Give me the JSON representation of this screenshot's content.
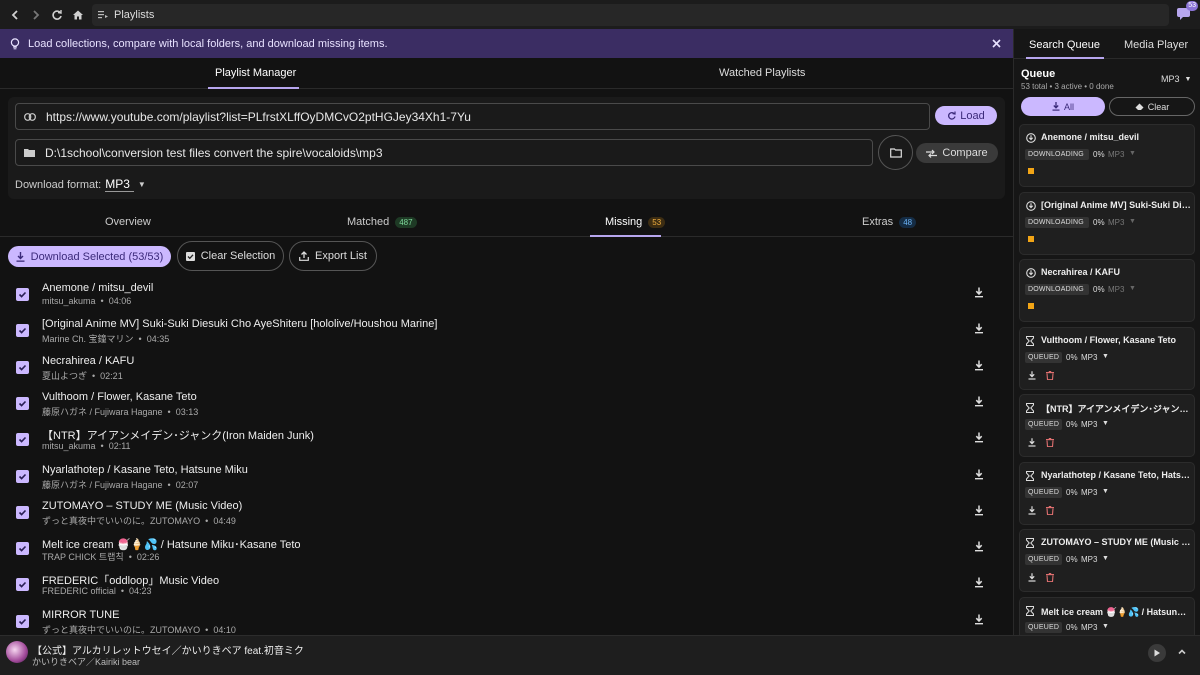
{
  "topbar": {
    "address": "Playlists",
    "notification_count": "53"
  },
  "info_bar": {
    "message": "Load collections, compare with local folders, and download missing items."
  },
  "top_tabs": [
    {
      "label": "Playlist Manager"
    },
    {
      "label": "Watched Playlists"
    }
  ],
  "form": {
    "url_value": "https://www.youtube.com/playlist?list=PLfrstXLffOyDMCvO2ptHGJey34Xh1-7Yu",
    "path_value": "D:\\1school\\conversion test files convert the spire\\vocaloids\\mp3",
    "load_label": "Load",
    "compare_label": "Compare",
    "format_label": "Download format:",
    "format_value": "MP3"
  },
  "sub_tabs": [
    {
      "label": "Overview",
      "badge": ""
    },
    {
      "label": "Matched",
      "badge": "487"
    },
    {
      "label": "Missing",
      "badge": "53"
    },
    {
      "label": "Extras",
      "badge": "48"
    }
  ],
  "actions": {
    "download_selected": "Download Selected (53/53)",
    "clear_selection": "Clear Selection",
    "export_list": "Export List"
  },
  "tracks": [
    {
      "title": "Anemone / mitsu_devil",
      "channel": "mitsu_akuma",
      "duration": "04:06"
    },
    {
      "title": "[Original Anime MV] Suki-Suki Diesuki Cho AyeShiteru [hololive/Houshou Marine]",
      "channel": "Marine Ch. 宝鐘マリン",
      "duration": "04:35"
    },
    {
      "title": "Necrahirea / KAFU",
      "channel": "夏山よつぎ",
      "duration": "02:21"
    },
    {
      "title": "Vulthoom / Flower, Kasane Teto",
      "channel": "藤原ハガネ / Fujiwara Hagane",
      "duration": "03:13"
    },
    {
      "title": "【NTR】アイアンメイデン･ジャンク(Iron Maiden Junk)",
      "channel": "mitsu_akuma",
      "duration": "02:11"
    },
    {
      "title": "Nyarlathotep / Kasane Teto, Hatsune Miku",
      "channel": "藤原ハガネ / Fujiwara Hagane",
      "duration": "02:07"
    },
    {
      "title": "ZUTOMAYO – STUDY ME (Music Video)",
      "channel": "ずっと真夜中でいいのに。ZUTOMAYO",
      "duration": "04:49"
    },
    {
      "title": "Melt ice cream 🍧🍦💦 / Hatsune Miku･Kasane Teto",
      "channel": "TRAP CHICK 트랩칙",
      "duration": "02:26"
    },
    {
      "title": "FREDERIC「oddloop」Music Video",
      "channel": "FREDERIC official",
      "duration": "04:23"
    },
    {
      "title": "MIRROR TUNE",
      "channel": "ずっと真夜中でいいのに。ZUTOMAYO",
      "duration": "04:10"
    }
  ],
  "player": {
    "title": "【公式】アルカリレットウセイ／かいりきベア feat.初音ミク",
    "artist": "かいりきベア／Kairiki bear"
  },
  "side": {
    "tabs": [
      {
        "label": "Search Queue"
      },
      {
        "label": "Media Player"
      }
    ],
    "queue_title": "Queue",
    "queue_stats": "53 total • 3 active • 0 done",
    "queue_format": "MP3",
    "all_label": "All",
    "clear_label": "Clear",
    "items": [
      {
        "name": "Anemone / mitsu_devil",
        "status": "DOWNLOADING",
        "pct": "0%",
        "fmt": "MP3"
      },
      {
        "name": "[Original Anime MV] Suki-Suki Diesuki Cho AyeShiteru [hololive/Houshou Marine]",
        "status": "DOWNLOADING",
        "pct": "0%",
        "fmt": "MP3"
      },
      {
        "name": "Necrahirea / KAFU",
        "status": "DOWNLOADING",
        "pct": "0%",
        "fmt": "MP3"
      },
      {
        "name": "Vulthoom / Flower, Kasane Teto",
        "status": "QUEUED",
        "pct": "0%",
        "fmt": "MP3"
      },
      {
        "name": "【NTR】アイアンメイデン･ジャンク(Iron Maiden Junk)",
        "status": "QUEUED",
        "pct": "0%",
        "fmt": "MP3"
      },
      {
        "name": "Nyarlathotep / Kasane Teto, Hatsune Miku",
        "status": "QUEUED",
        "pct": "0%",
        "fmt": "MP3"
      },
      {
        "name": "ZUTOMAYO – STUDY ME (Music Video)",
        "status": "QUEUED",
        "pct": "0%",
        "fmt": "MP3"
      },
      {
        "name": "Melt ice cream 🍧🍦💦 / Hatsune Miku･Kasane Teto",
        "status": "QUEUED",
        "pct": "0%",
        "fmt": "MP3"
      }
    ]
  },
  "colors": {
    "accent": "#cbb8ff",
    "info_bar": "#3b2d63",
    "downloading_progress": "#f2a516",
    "delete": "#e07070"
  }
}
